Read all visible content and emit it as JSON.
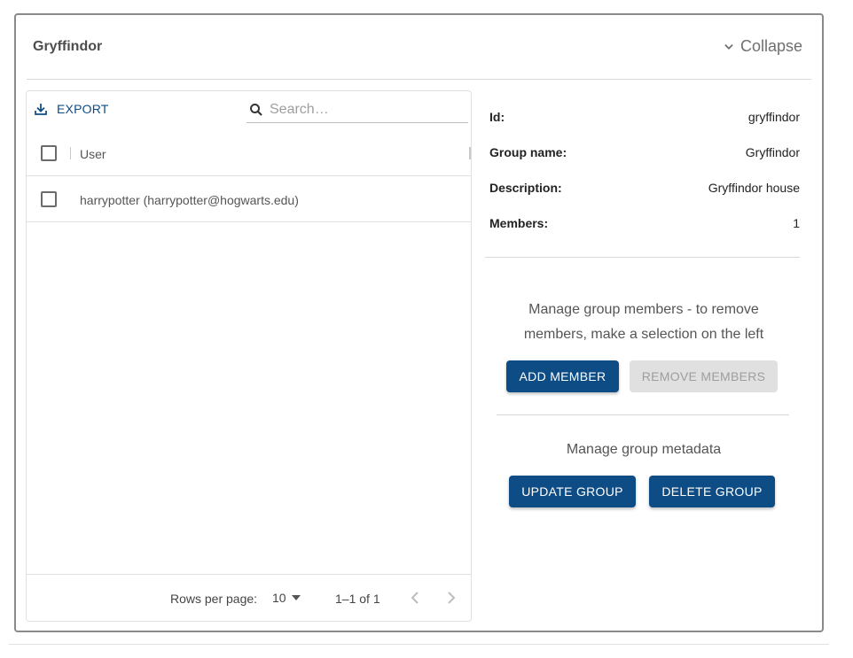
{
  "panel": {
    "title": "Gryffindor",
    "collapse_label": "Collapse"
  },
  "grid": {
    "export_label": "EXPORT",
    "search_placeholder": "Search…",
    "column_header": "User",
    "rows": [
      {
        "user": "harrypotter (harrypotter@hogwarts.edu)"
      }
    ],
    "footer": {
      "rows_per_page_label": "Rows per page:",
      "rows_per_page_value": "10",
      "page_info": "1–1 of 1"
    }
  },
  "details": {
    "id_label": "Id:",
    "id_value": "gryffindor",
    "group_name_label": "Group name:",
    "group_name_value": "Gryffindor",
    "description_label": "Description:",
    "description_value": "Gryffindor house",
    "members_label": "Members:",
    "members_value": "1"
  },
  "members_section": {
    "text": "Manage group members - to remove members, make a selection on the left",
    "add_member_label": "ADD MEMBER",
    "remove_members_label": "REMOVE MEMBERS"
  },
  "metadata_section": {
    "text": "Manage group metadata",
    "update_group_label": "UPDATE GROUP",
    "delete_group_label": "DELETE GROUP"
  },
  "colors": {
    "primary": "#0e4c85",
    "disabled_bg": "#e0e0e0",
    "disabled_text": "#9e9e9e"
  }
}
